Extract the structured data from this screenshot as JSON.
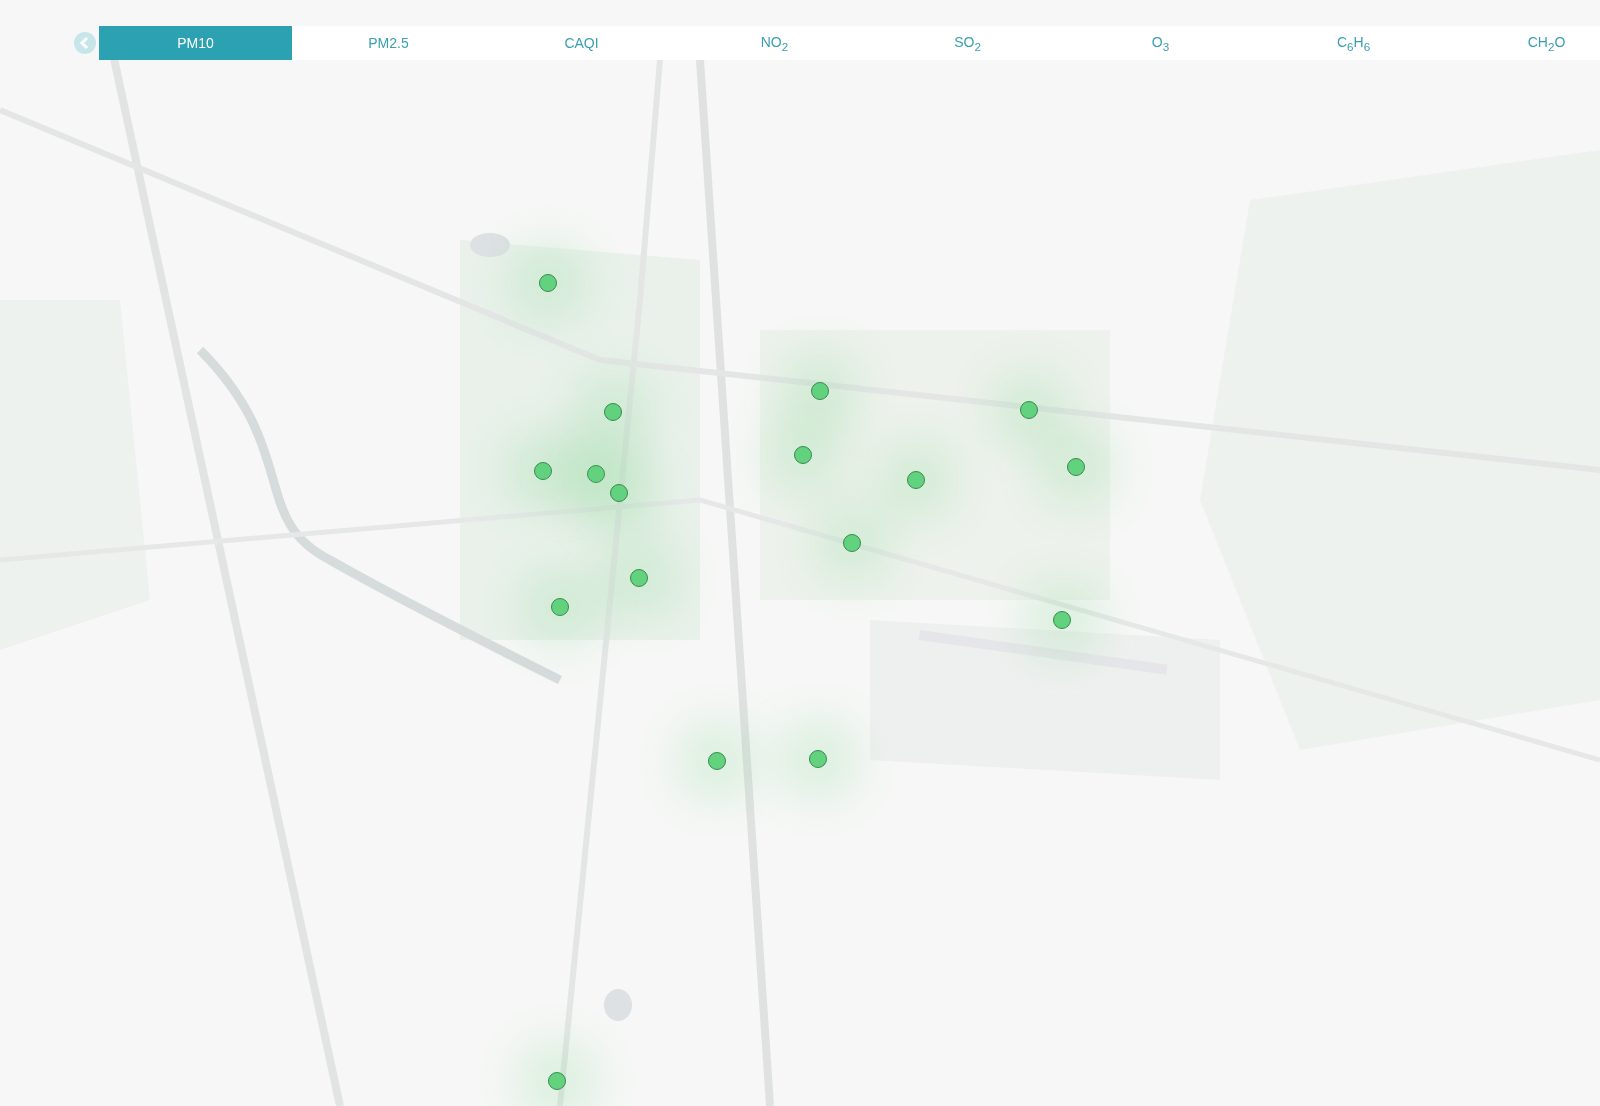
{
  "tabs": [
    {
      "label": "PM10",
      "selected": true
    },
    {
      "label": "PM2.5",
      "selected": false
    },
    {
      "label": "CAQI",
      "selected": false
    },
    {
      "label": "NO$_{2}$",
      "selected": false
    },
    {
      "label": "SO$_{2}$",
      "selected": false
    },
    {
      "label": "O$_{3}$",
      "selected": false
    },
    {
      "label": "C$_{6}$H$_{6}$",
      "selected": false
    },
    {
      "label": "CH$_{2}$O",
      "selected": false
    }
  ]
}
